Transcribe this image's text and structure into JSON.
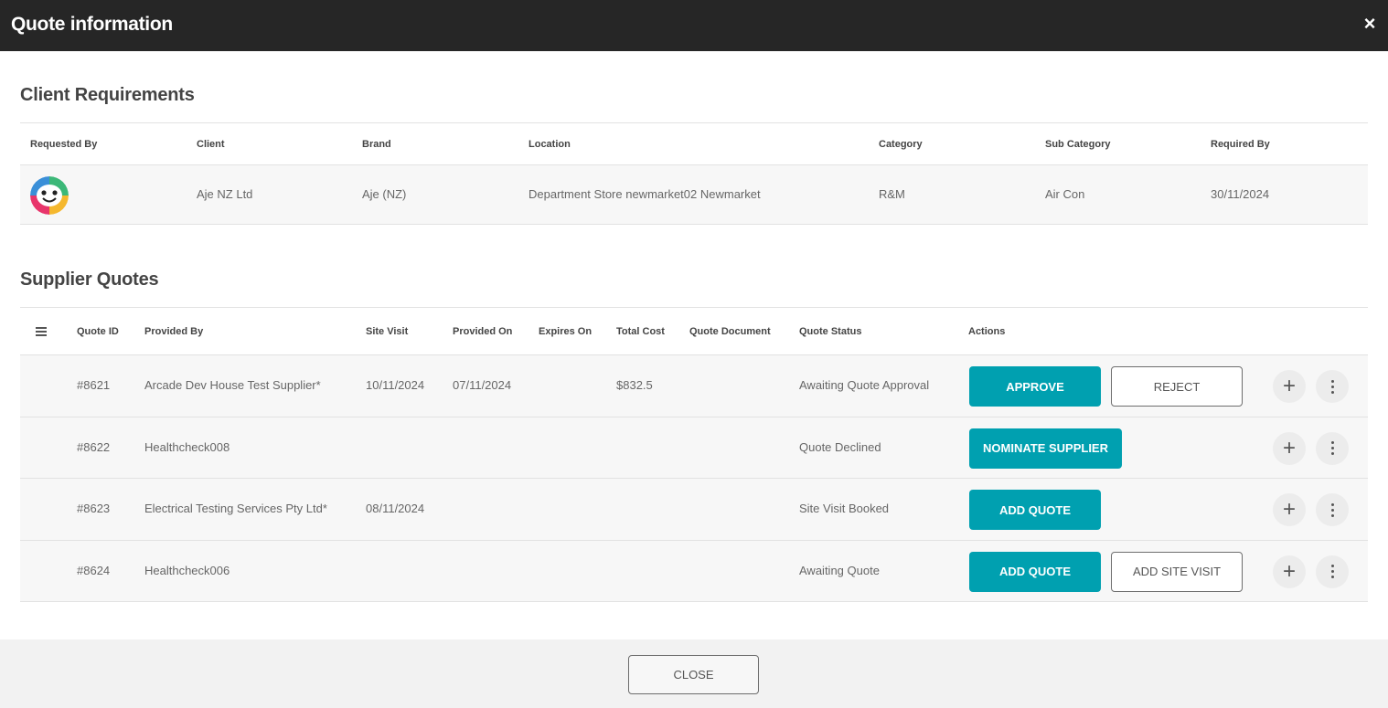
{
  "modal": {
    "title": "Quote information",
    "close_icon": "×"
  },
  "client_requirements": {
    "section_title": "Client Requirements",
    "headers": [
      "Requested By",
      "Client",
      "Brand",
      "Location",
      "Category",
      "Sub Category",
      "Required By"
    ],
    "row": {
      "client": "Aje NZ Ltd",
      "brand": "Aje (NZ)",
      "location": "Department Store newmarket02 Newmarket",
      "category": "R&M",
      "sub_category": "Air Con",
      "required_by": "30/11/2024"
    }
  },
  "supplier_quotes": {
    "section_title": "Supplier Quotes",
    "headers": [
      "Quote ID",
      "Provided By",
      "Site Visit",
      "Provided On",
      "Expires On",
      "Total Cost",
      "Quote Document",
      "Quote Status",
      "Actions"
    ],
    "rows": [
      {
        "quote_id": "#8621",
        "provided_by": "Arcade Dev House Test Supplier*",
        "site_visit": "10/11/2024",
        "provided_on": "07/11/2024",
        "expires_on": "",
        "total_cost": "$832.5",
        "quote_document": "",
        "status": "Awaiting Quote Approval",
        "primary_action": "APPROVE",
        "secondary_action": "REJECT"
      },
      {
        "quote_id": "#8622",
        "provided_by": "Healthcheck008",
        "site_visit": "",
        "provided_on": "",
        "expires_on": "",
        "total_cost": "",
        "quote_document": "",
        "status": "Quote Declined",
        "primary_action": "NOMINATE SUPPLIER",
        "secondary_action": ""
      },
      {
        "quote_id": "#8623",
        "provided_by": "Electrical Testing Services Pty Ltd*",
        "site_visit": "08/11/2024",
        "provided_on": "",
        "expires_on": "",
        "total_cost": "",
        "quote_document": "",
        "status": "Site Visit Booked",
        "primary_action": "ADD QUOTE",
        "secondary_action": ""
      },
      {
        "quote_id": "#8624",
        "provided_by": "Healthcheck006",
        "site_visit": "",
        "provided_on": "",
        "expires_on": "",
        "total_cost": "",
        "quote_document": "",
        "status": "Awaiting Quote",
        "primary_action": "ADD QUOTE",
        "secondary_action": "ADD SITE VISIT"
      }
    ]
  },
  "footer": {
    "close_label": "CLOSE"
  },
  "colors": {
    "primary": "#00a0b0",
    "titlebar": "#262626"
  },
  "icons": {
    "modal_close": "close-icon",
    "column_menu": "menu-icon",
    "add": "plus-icon",
    "more": "kebab-menu-icon"
  }
}
